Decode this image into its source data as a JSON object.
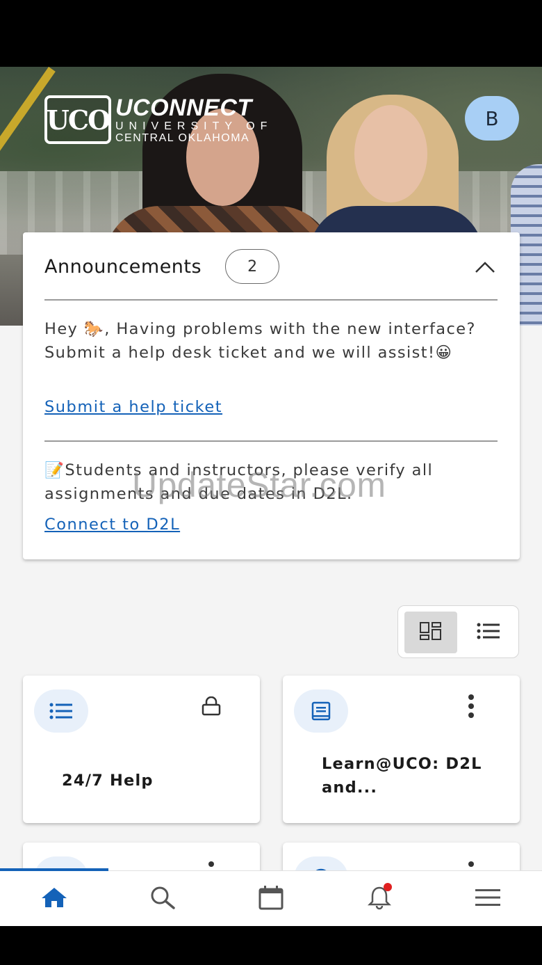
{
  "header": {
    "logo_mark": "UCO",
    "logo_title": "UCONNECT",
    "logo_line1": "UNIVERSITY OF",
    "logo_line2": "CENTRAL OKLAHOMA",
    "avatar_initial": "B"
  },
  "announcements": {
    "title": "Announcements",
    "count": "2",
    "items": [
      {
        "text": "Hey 🐎, Having problems with the new interface? Submit a help desk ticket and we will assist!😀",
        "link": "Submit a help ticket"
      },
      {
        "text": "📝Students and instructors, please verify all assignments and due dates in D2L.",
        "link": "Connect to D2L"
      }
    ]
  },
  "watermark": "UpdateStar.com",
  "view_toggle": {
    "options": [
      "grid-view-icon",
      "list-view-icon"
    ],
    "selected": "grid"
  },
  "tiles": [
    {
      "label": "24/7 Help",
      "icon": "list-icon",
      "action": "lock-icon"
    },
    {
      "label": "Learn@UCO: D2L and...",
      "icon": "book-icon",
      "action": "more-vert-icon"
    },
    {
      "label": "",
      "icon": "calendar-icon",
      "action": "more-vert-icon"
    },
    {
      "label": "",
      "icon": "info-icon",
      "action": "more-vert-icon"
    }
  ],
  "bottom_nav": {
    "items": [
      "home-icon",
      "search-icon",
      "calendar-icon",
      "bell-icon",
      "menu-icon"
    ],
    "active": "home",
    "accent": "#1462b8",
    "notification_color": "#e02020"
  }
}
